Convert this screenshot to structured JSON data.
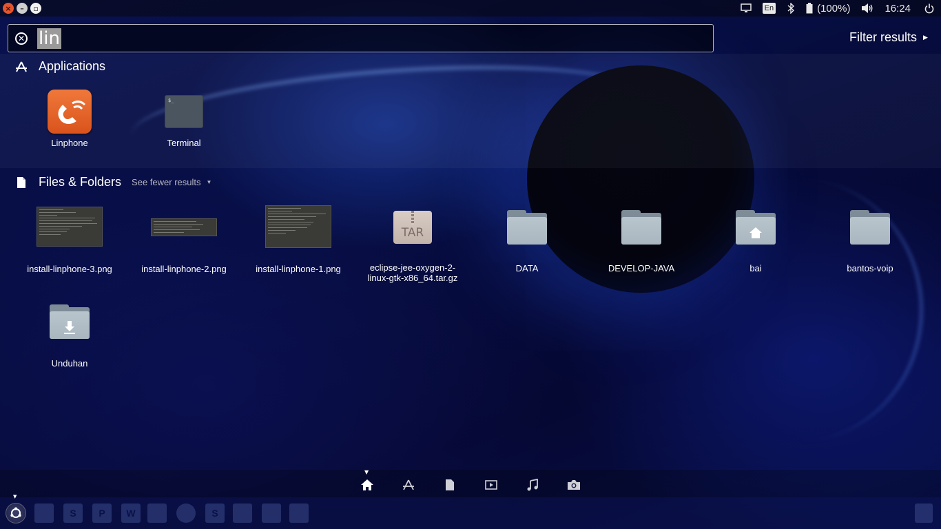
{
  "top_panel": {
    "language": "En",
    "battery": "(100%)",
    "clock": "16:24"
  },
  "search": {
    "query": "lin",
    "filter_label": "Filter results"
  },
  "applications": {
    "title": "Applications",
    "items": [
      {
        "label": "Linphone",
        "icon": "linphone-icon"
      },
      {
        "label": "Terminal",
        "icon": "terminal-icon",
        "prompt": "$_"
      }
    ]
  },
  "files": {
    "title": "Files & Folders",
    "see_fewer": "See fewer results",
    "items": [
      {
        "label": "install-linphone-3.png",
        "icon": "image-thumbnail"
      },
      {
        "label": "install-linphone-2.png",
        "icon": "image-thumbnail"
      },
      {
        "label": "install-linphone-1.png",
        "icon": "image-thumbnail"
      },
      {
        "label": "eclipse-jee-oxygen-2-linux-gtk-x86_64.tar.gz",
        "icon": "tar-archive-icon",
        "badge": "TAR"
      },
      {
        "label": "DATA",
        "icon": "folder-icon"
      },
      {
        "label": "DEVELOP-JAVA",
        "icon": "folder-icon"
      },
      {
        "label": "bai",
        "icon": "home-folder-icon"
      },
      {
        "label": "bantos-voip",
        "icon": "folder-icon"
      },
      {
        "label": "Unduhan",
        "icon": "downloads-folder-icon"
      }
    ]
  },
  "lenses": [
    {
      "name": "home-lens",
      "active": true
    },
    {
      "name": "applications-lens",
      "active": false
    },
    {
      "name": "files-lens",
      "active": false
    },
    {
      "name": "video-lens",
      "active": false
    },
    {
      "name": "music-lens",
      "active": false
    },
    {
      "name": "photo-lens",
      "active": false
    }
  ],
  "colors": {
    "accent_orange": "#e5542c",
    "folder": "#a9b6bf",
    "background": "#07092e"
  }
}
